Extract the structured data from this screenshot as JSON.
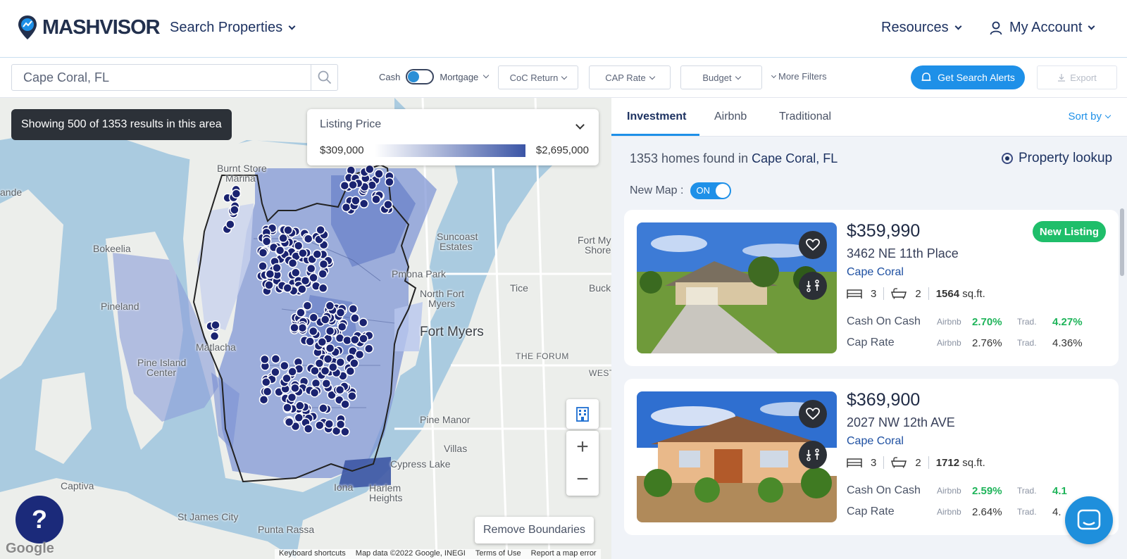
{
  "header": {
    "logo_text": "MASHVISOR",
    "search_properties": "Search Properties",
    "resources": "Resources",
    "my_account": "My Account"
  },
  "filters": {
    "location_value": "Cape Coral, FL",
    "cash_label": "Cash",
    "mortgage_label": "Mortgage",
    "coc_return": "CoC Return",
    "cap_rate": "CAP Rate",
    "budget": "Budget",
    "more_filters": "More Filters",
    "get_alerts": "Get Search Alerts",
    "export": "Export"
  },
  "map": {
    "results_text": "Showing 500 of 1353 results in this area",
    "legend_title": "Listing Price",
    "legend_min": "$309,000",
    "legend_max": "$2,695,000",
    "remove_boundaries": "Remove Boundaries",
    "help": "?",
    "google": "Google",
    "labels": {
      "burnt_store_1": "Burnt Store",
      "burnt_store_2": "Marina",
      "suncoast_1": "Suncoast",
      "suncoast_2": "Estates",
      "bokeelia": "Bokeelia",
      "pinelano": "Pineland",
      "matlacha": "Matlacha",
      "pine_island_1": "Pine Island",
      "pine_island_2": "Center",
      "fort_myers": "Fort Myers",
      "north_fort_1": "North Fort",
      "north_fort_2": "Myers",
      "pmona_park": "Pmona Park",
      "tice": "Tice",
      "buck": "Buck",
      "fort_myers_shores_1": "Fort My",
      "fort_myers_shores_2": "Shore",
      "the_forum": "THE FORUM",
      "west": "WEST",
      "pine_manor": "Pine Manor",
      "villas": "Villas",
      "cypress_lake": "Cypress Lake",
      "iona": "Iona",
      "harlem_1": "Harlem",
      "harlem_2": "Heights",
      "captiva": "Captiva",
      "st_james": "St James City",
      "punta_rassa": "Punta Rassa",
      "ande": "ande"
    },
    "attribution": [
      "Keyboard shortcuts",
      "Map data ©2022 Google, INEGI",
      "Terms of Use",
      "Report a map error"
    ]
  },
  "panel": {
    "tabs": [
      "Investment",
      "Airbnb",
      "Traditional"
    ],
    "sort_by": "Sort by",
    "homes_found_prefix": "1353 homes found in",
    "homes_found_city": "Cape Coral, FL",
    "property_lookup": "Property lookup",
    "new_map_label": "New Map :",
    "new_map_state": "ON",
    "listings": [
      {
        "price": "$359,990",
        "address": "3462 NE 11th Place",
        "city": "Cape Coral",
        "beds": "3",
        "baths": "2",
        "sqft": "1564",
        "sqft_unit": "sq.ft.",
        "badge": "New Listing",
        "coc_label": "Cash On Cash",
        "cap_label": "Cap Rate",
        "airbnb_label": "Airbnb",
        "trad_label": "Trad.",
        "coc_airbnb": "2.70%",
        "coc_trad": "4.27%",
        "cap_airbnb": "2.76%",
        "cap_trad": "4.36%"
      },
      {
        "price": "$369,900",
        "address": "2027 NW 12th AVE",
        "city": "Cape Coral",
        "beds": "3",
        "baths": "2",
        "sqft": "1712",
        "sqft_unit": "sq.ft.",
        "coc_label": "Cash On Cash",
        "cap_label": "Cap Rate",
        "airbnb_label": "Airbnb",
        "trad_label": "Trad.",
        "coc_airbnb": "2.59%",
        "coc_trad": "4.1",
        "cap_airbnb": "2.64%",
        "cap_trad": "4."
      }
    ]
  },
  "colors": {
    "accent": "#1e90e8",
    "navy": "#1d3261",
    "green": "#1fb45a",
    "marker": "#1a2370"
  }
}
